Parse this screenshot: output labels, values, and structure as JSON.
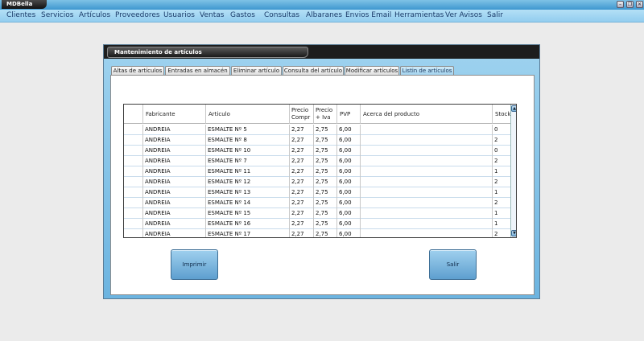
{
  "window": {
    "app_title": "MDBella",
    "minimize_symbol": "–",
    "restore_symbol": "❐",
    "close_symbol": "✕"
  },
  "menu": [
    "Clientes",
    "Servicios",
    "Artículos",
    "Proveedores",
    "Usuarios",
    "Ventas",
    "Gastos",
    "Consultas",
    "Albaranes",
    "Envios Email",
    "Herramientas",
    "Ver Avisos",
    "Salir"
  ],
  "dialog": {
    "title": "Mantenimiento de artículos",
    "tabs": [
      "Altas de artículos",
      "Entradas en almacén",
      "Eliminar artículo",
      "Consulta del artículo",
      "Modificar artículos",
      "Listin de artículos"
    ],
    "active_tab": "Listin de artículos"
  },
  "table": {
    "headers": {
      "fabricante": "Fabricante",
      "articulo": "Articulo",
      "precio_compra": "Precio Compr",
      "precio_iva": "Precio + Iva",
      "pvp": "PVP",
      "acerca": "Acerca del producto",
      "stock": "Stock"
    },
    "rows": [
      [
        "ANDREIA",
        "ESMALTE Nº 5",
        "2,27",
        "2,75",
        "6,00",
        "",
        "0"
      ],
      [
        "ANDREIA",
        "ESMALTE Nº 8",
        "2,27",
        "2,75",
        "6,00",
        "",
        "2"
      ],
      [
        "ANDREIA",
        "ESMALTE Nº 10",
        "2,27",
        "2,75",
        "6,00",
        "",
        "0"
      ],
      [
        "ANDREIA",
        "ESMALTE Nº 7",
        "2,27",
        "2,75",
        "6,00",
        "",
        "2"
      ],
      [
        "ANDREIA",
        "ESMALTE Nº 11",
        "2,27",
        "2,75",
        "6,00",
        "",
        "1"
      ],
      [
        "ANDREIA",
        "ESMALTE Nº 12",
        "2,27",
        "2,75",
        "6,00",
        "",
        "2"
      ],
      [
        "ANDREIA",
        "ESMALTE Nº 13",
        "2,27",
        "2,75",
        "6,00",
        "",
        "1"
      ],
      [
        "ANDREIA",
        "ESMALTE Nº 14",
        "2,27",
        "2,75",
        "6,00",
        "",
        "2"
      ],
      [
        "ANDREIA",
        "ESMALTE Nº 15",
        "2,27",
        "2,75",
        "6,00",
        "",
        "1"
      ],
      [
        "ANDREIA",
        "ESMALTE Nº 16",
        "2,27",
        "2,75",
        "6,00",
        "",
        "1"
      ],
      [
        "ANDREIA",
        "ESMALTE Nº 17",
        "2,27",
        "2,75",
        "6,00",
        "",
        "2"
      ]
    ],
    "scroll_up_symbol": "▲",
    "scroll_down_symbol": "▼"
  },
  "buttons": {
    "print_label": "Imprimir",
    "exit_label": "Salir"
  },
  "colors": {
    "menubar": "#a2d6f2",
    "dialog_blue": "#84c4e8",
    "grid_line": "#c9dcec"
  }
}
